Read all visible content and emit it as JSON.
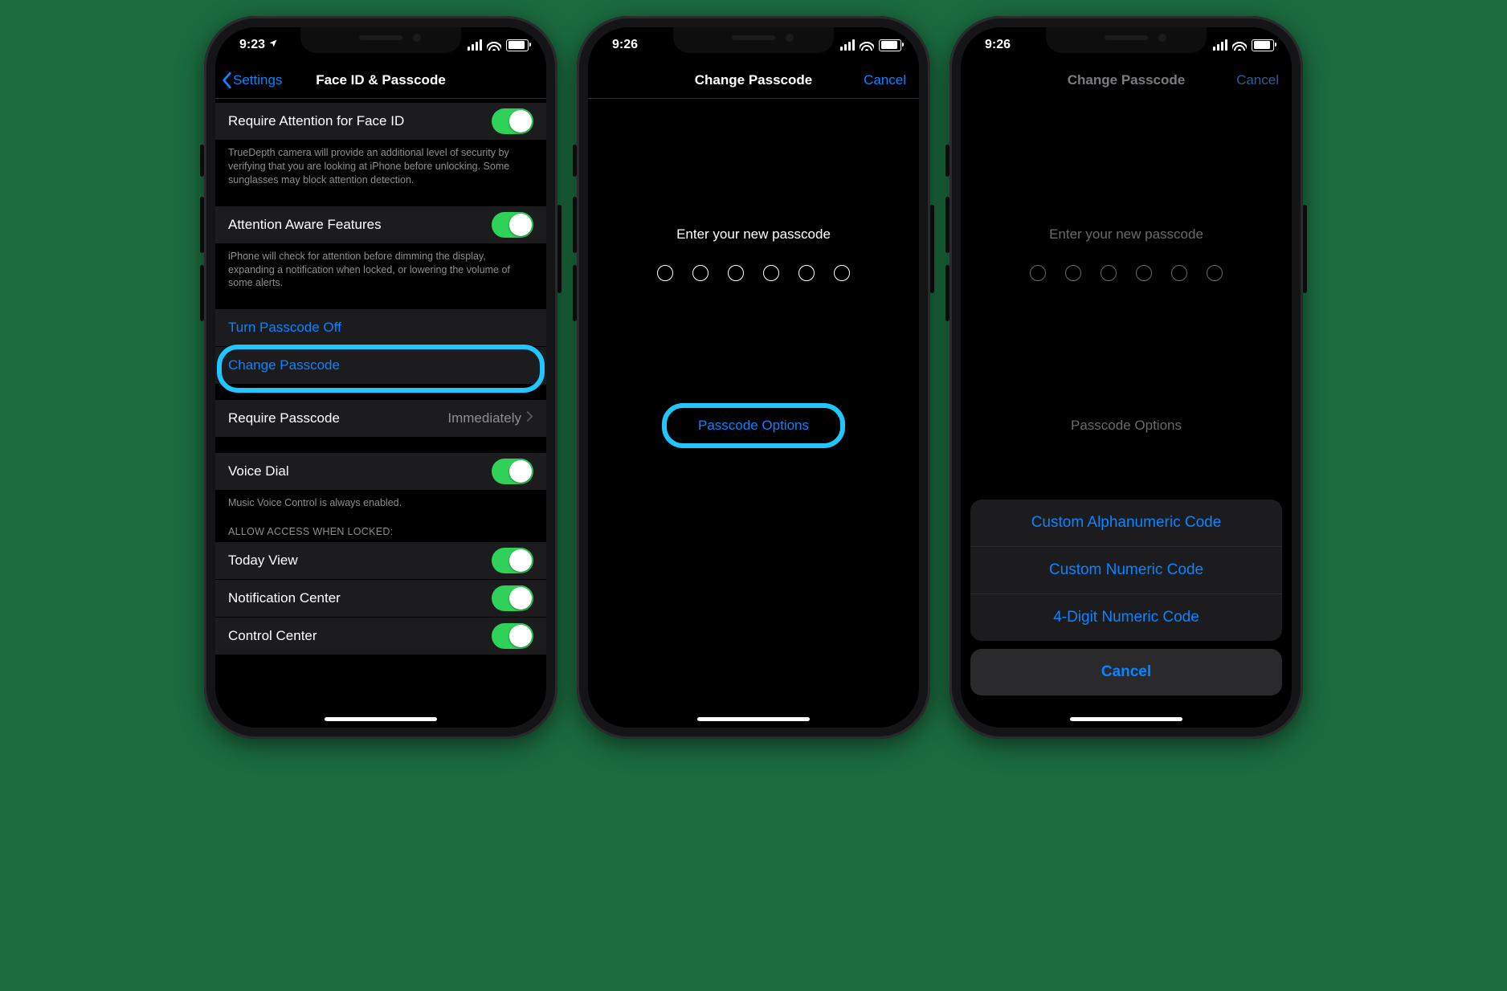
{
  "phone1": {
    "status_time": "9:23",
    "nav_back": "Settings",
    "nav_title": "Face ID & Passcode",
    "row_attention_label": "Require Attention for Face ID",
    "row_attention_footer": "TrueDepth camera will provide an additional level of security by verifying that you are looking at iPhone before unlocking. Some sunglasses may block attention detection.",
    "row_aware_label": "Attention Aware Features",
    "row_aware_footer": "iPhone will check for attention before dimming the display, expanding a notification when locked, or lowering the volume of some alerts.",
    "row_turnoff": "Turn Passcode Off",
    "row_change": "Change Passcode",
    "row_require_label": "Require Passcode",
    "row_require_value": "Immediately",
    "row_voice_label": "Voice Dial",
    "row_voice_footer": "Music Voice Control is always enabled.",
    "header_allow": "Allow Access When Locked:",
    "row_today": "Today View",
    "row_notif": "Notification Center",
    "row_control": "Control Center"
  },
  "phone2": {
    "status_time": "9:26",
    "nav_title": "Change Passcode",
    "nav_cancel": "Cancel",
    "prompt": "Enter your new passcode",
    "options": "Passcode Options"
  },
  "phone3": {
    "status_time": "9:26",
    "nav_title": "Change Passcode",
    "nav_cancel": "Cancel",
    "prompt": "Enter your new passcode",
    "options": "Passcode Options",
    "sheet_alpha": "Custom Alphanumeric Code",
    "sheet_numeric": "Custom Numeric Code",
    "sheet_four": "4-Digit Numeric Code",
    "sheet_cancel": "Cancel"
  }
}
